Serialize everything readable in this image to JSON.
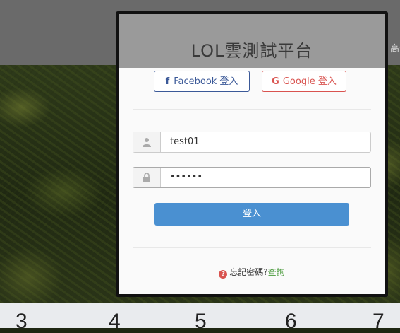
{
  "header": {
    "fragment": "高介"
  },
  "modal": {
    "title": "LOL雲測試平台",
    "facebook_label": "Facebook 登入",
    "google_label": "Google 登入",
    "username_value": "test01",
    "password_value": "••••••",
    "login_label": "登入",
    "forgot_text": "忘記密碼?",
    "query_link": "查詢"
  },
  "bottom": {
    "numbers": [
      "3",
      "4",
      "5",
      "6",
      "7"
    ]
  },
  "colors": {
    "facebook": "#3b5998",
    "google": "#d9534f",
    "primary_button": "#4a90d1",
    "link": "#4a9a3c"
  },
  "icons": {
    "facebook": "facebook-icon",
    "google": "google-icon",
    "user": "user-icon",
    "lock": "lock-icon",
    "question": "question-circle-icon"
  }
}
